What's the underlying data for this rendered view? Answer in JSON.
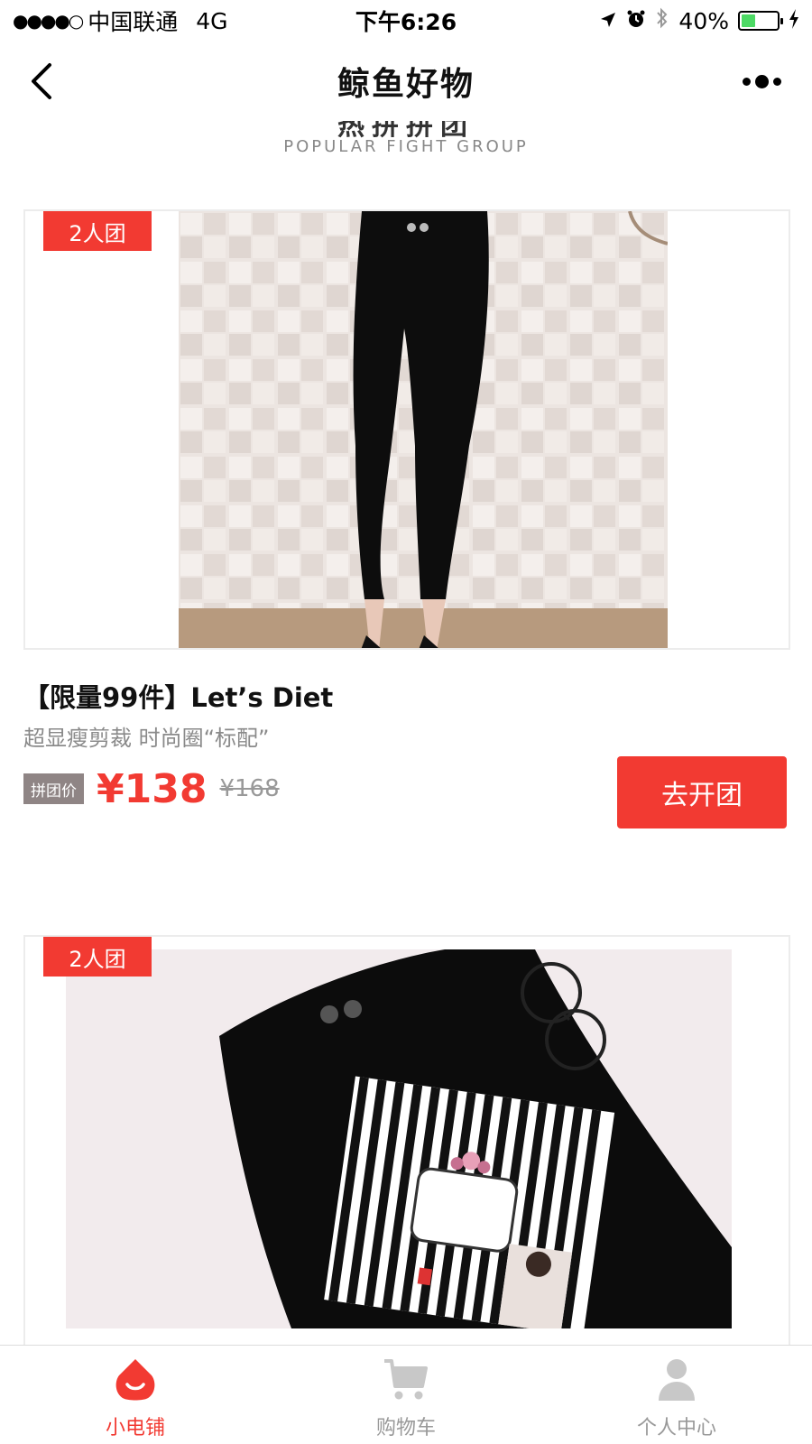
{
  "status_bar": {
    "carrier": "中国联通",
    "network": "4G",
    "time": "下午6:26",
    "battery_percent": "40%",
    "battery_level": 0.4
  },
  "nav": {
    "title": "鲸鱼好物"
  },
  "section": {
    "title_cn": "热拼拼团",
    "title_en": "POPULAR FIGHT GROUP"
  },
  "products": [
    {
      "badge": "2人团",
      "title": "【限量99件】Let’s Diet",
      "subtitle": "超显瘦剪裁 时尚圈“标配”",
      "price_tag": "拼团价",
      "price": "¥138",
      "original_price": "¥168",
      "button": "去开团"
    },
    {
      "badge": "2人团"
    }
  ],
  "tabs": [
    {
      "label": "小电铺",
      "icon": "shop-icon",
      "active": true
    },
    {
      "label": "购物车",
      "icon": "cart-icon",
      "active": false
    },
    {
      "label": "个人中心",
      "icon": "user-icon",
      "active": false
    }
  ],
  "colors": {
    "accent": "#f23a32",
    "price_tag_bg": "#8f8585",
    "tab_inactive": "#999999"
  }
}
